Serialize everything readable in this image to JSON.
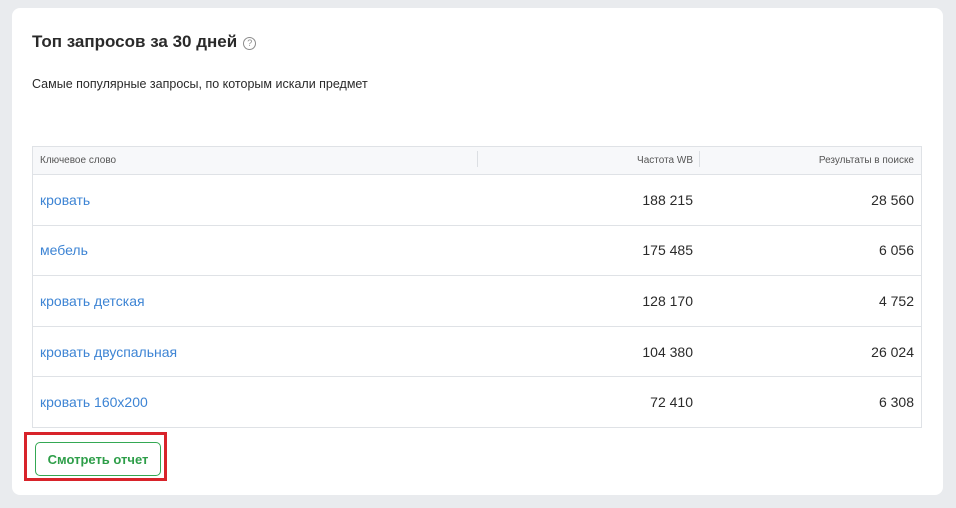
{
  "card": {
    "title": "Топ запросов за 30 дней",
    "help_glyph": "?",
    "subtitle": "Самые популярные запросы, по которым искали предмет"
  },
  "table": {
    "headers": [
      "Ключевое слово",
      "Частота WB",
      "Результаты в поиске"
    ],
    "rows": [
      {
        "keyword": "кровать",
        "frequency": "188 215",
        "results": "28 560"
      },
      {
        "keyword": "мебель",
        "frequency": "175 485",
        "results": "6 056"
      },
      {
        "keyword": "кровать детская",
        "frequency": "128 170",
        "results": "4 752"
      },
      {
        "keyword": "кровать двуспальная",
        "frequency": "104 380",
        "results": "26 024"
      },
      {
        "keyword": "кровать 160х200",
        "frequency": "72 410",
        "results": "6 308"
      }
    ]
  },
  "actions": {
    "view_report_label": "Смотреть отчет"
  },
  "colors": {
    "link": "#3d84d4",
    "button_green": "#2e9e49",
    "highlight_red": "#d8232a"
  }
}
